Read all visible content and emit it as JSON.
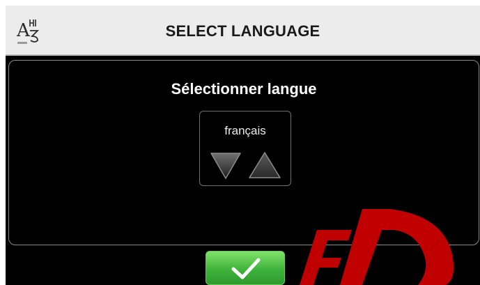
{
  "header": {
    "title": "SELECT LANGUAGE",
    "icon": "language-icon"
  },
  "panel": {
    "title": "Sélectionner langue"
  },
  "language_selector": {
    "value": "français",
    "down_icon": "triangle-down-icon",
    "up_icon": "triangle-up-icon"
  },
  "confirm": {
    "icon": "checkmark-icon"
  },
  "colors": {
    "header_bg": "#ececec",
    "screen_bg": "#000000",
    "confirm_green": "#3fb33c",
    "watermark_red": "#c00000"
  }
}
